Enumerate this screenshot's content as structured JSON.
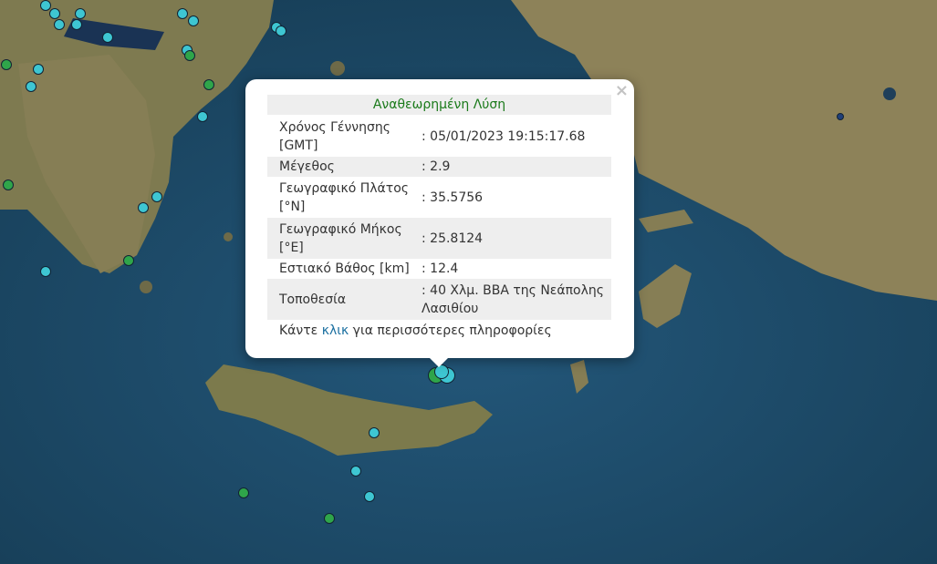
{
  "popup": {
    "title": "Αναθεωρημένη Λύση",
    "close": "×",
    "rows": [
      {
        "label": "Χρόνος Γέννησης [GMT]",
        "value": ": 05/01/2023 19:15:17.68"
      },
      {
        "label": "Μέγεθος",
        "value": ": 2.9"
      },
      {
        "label": "Γεωγραφικό Πλάτος [°N]",
        "value": ": 35.5756"
      },
      {
        "label": "Γεωγραφικό Μήκος [°E]",
        "value": ": 25.8124"
      },
      {
        "label": "Εστιακό Βάθος [km]",
        "value": ": 12.4"
      },
      {
        "label": "Τοποθεσία",
        "value": ": 40 Χλμ. ΒΒΑ της Νεάπολης Λασιθίου"
      }
    ],
    "more_prefix": "Κάντε",
    "more_link": "κλικ",
    "more_suffix": "για περισσότερες πληροφορίες"
  },
  "colors": {
    "sea": "#1d4a63",
    "land": "#8a8158",
    "marker_cyan": "#3ec6d2",
    "marker_green": "#2fa54a",
    "title_green": "#1a7a1a",
    "link": "#1a6fa0"
  }
}
